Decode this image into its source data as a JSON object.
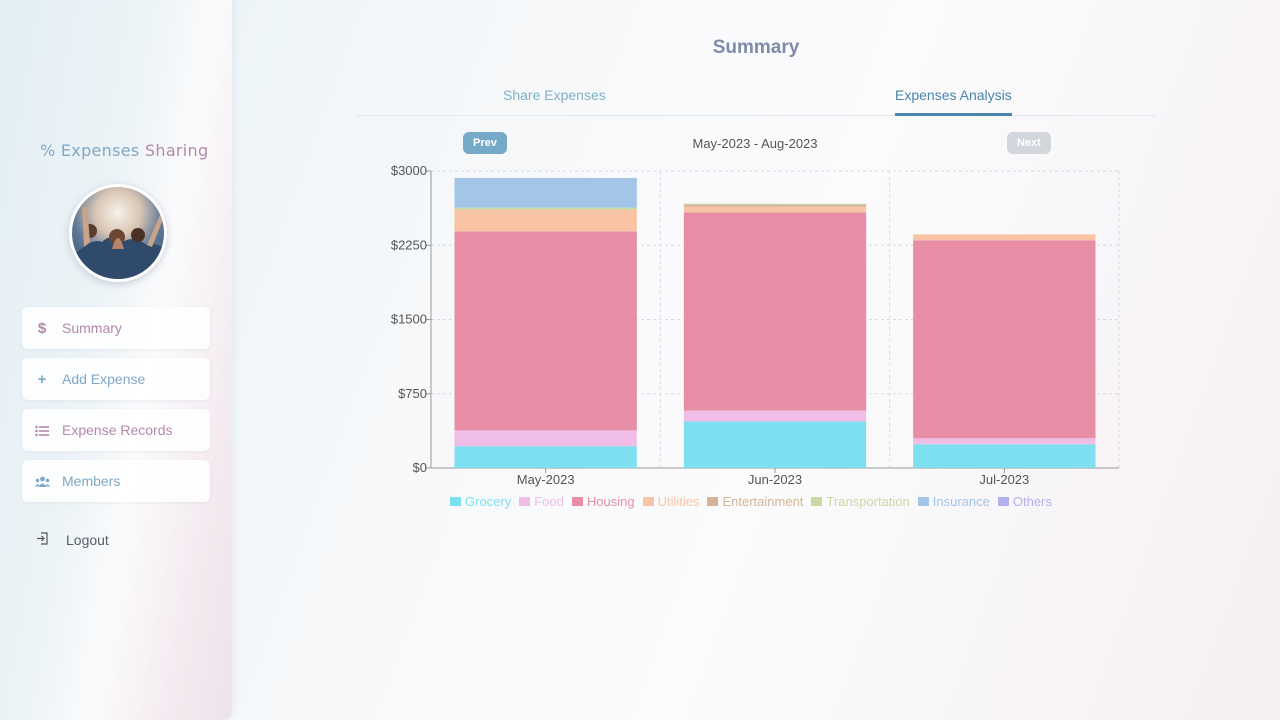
{
  "sidebar": {
    "brand_part1": "% Expenses ",
    "brand_part2": "Sharing",
    "items": [
      {
        "label": "Summary",
        "icon": "$"
      },
      {
        "label": "Add Expense",
        "icon": "+"
      },
      {
        "label": "Expense Records",
        "icon": "list"
      },
      {
        "label": "Members",
        "icon": "users"
      }
    ],
    "logout": "Logout"
  },
  "main": {
    "title": "Summary",
    "tabs": [
      {
        "label": "Share Expenses"
      },
      {
        "label": "Expenses Analysis",
        "active": true
      }
    ],
    "prev_label": "Prev",
    "next_label": "Next",
    "period": "May-2023 - Aug-2023"
  },
  "colors": {
    "Grocery": "#7ddff0",
    "Food": "#f0bde6",
    "Housing": "#e78ea6",
    "Utilities": "#f9c4a4",
    "Entertainment": "#d4b496",
    "Transportation": "#c8d9a8",
    "Insurance": "#a3c5e8",
    "Others": "#b3afef"
  },
  "chart_data": {
    "type": "bar",
    "stacked": true,
    "categories": [
      "May-2023",
      "Jun-2023",
      "Jul-2023"
    ],
    "ylim": [
      0,
      3000
    ],
    "yticks": [
      "$0",
      "$750",
      "$1500",
      "$2250",
      "$3000"
    ],
    "yvalues": [
      0,
      750,
      1500,
      2250,
      3000
    ],
    "grid": true,
    "legend_position": "bottom",
    "series": [
      {
        "name": "Grocery",
        "values": [
          220,
          470,
          240
        ]
      },
      {
        "name": "Food",
        "values": [
          160,
          110,
          60
        ]
      },
      {
        "name": "Housing",
        "values": [
          2010,
          2000,
          2000
        ]
      },
      {
        "name": "Utilities",
        "values": [
          220,
          60,
          60
        ]
      },
      {
        "name": "Entertainment",
        "values": [
          0,
          20,
          0
        ]
      },
      {
        "name": "Transportation",
        "values": [
          20,
          10,
          0
        ]
      },
      {
        "name": "Insurance",
        "values": [
          300,
          0,
          0
        ]
      },
      {
        "name": "Others",
        "values": [
          0,
          0,
          0
        ]
      }
    ]
  }
}
